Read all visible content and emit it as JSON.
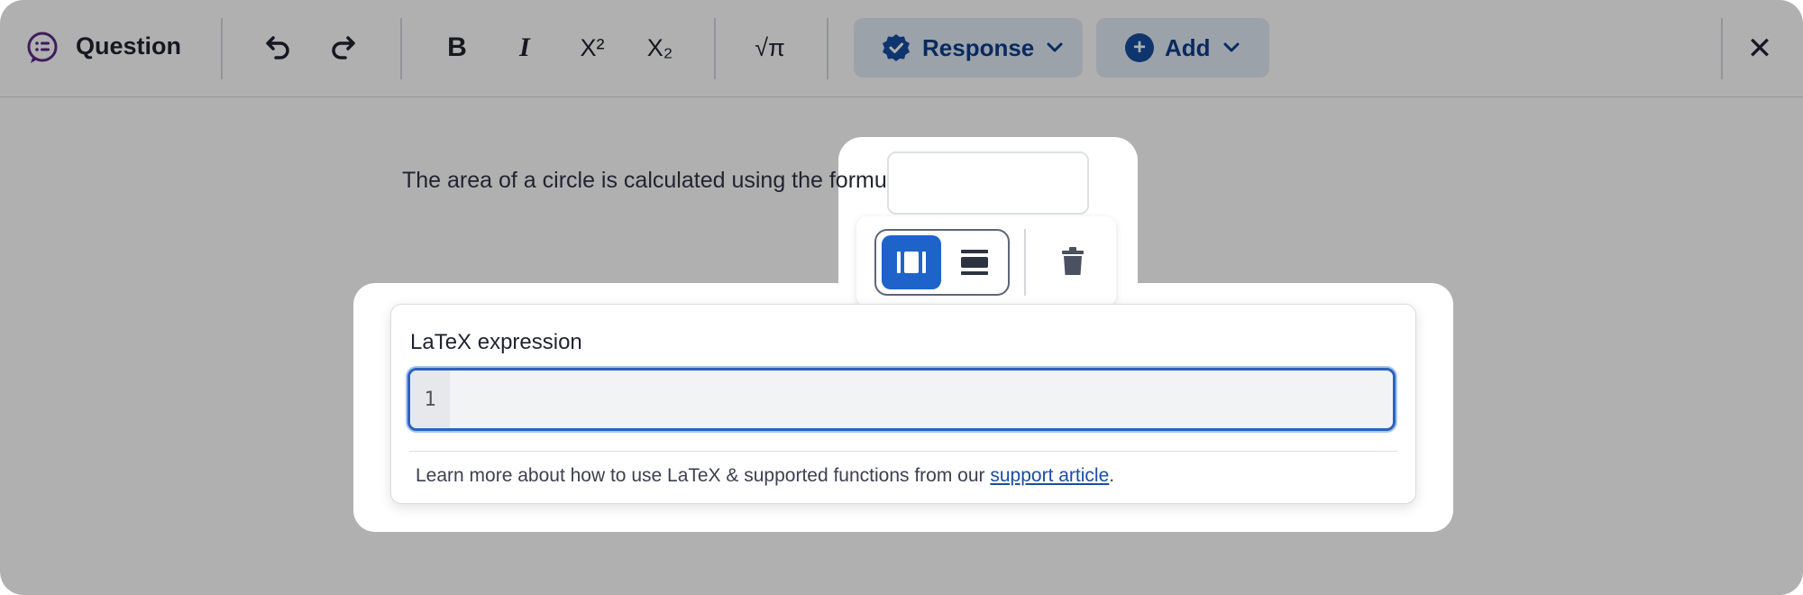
{
  "toolbar": {
    "title": "Question",
    "undo_icon": "undo-icon",
    "redo_icon": "redo-icon",
    "bold_glyph": "B",
    "italic_glyph": "I",
    "superscript_glyph": "X²",
    "subscript_glyph": "X₂",
    "math_glyph": "√π",
    "response_label": "Response",
    "add_label": "Add",
    "add_glyph": "+",
    "close_glyph": "✕"
  },
  "content": {
    "sentence": "The area of a circle is calculated using the formula"
  },
  "latex": {
    "title": "LaTeX expression",
    "line_number": "1",
    "help_prefix": "Learn more about how to use LaTeX & supported functions from our ",
    "help_link": "support article",
    "help_suffix": "."
  },
  "colors": {
    "accent": "#1e63c9",
    "pill_bg": "#e3ebf7",
    "pill_text": "#0e3e8a",
    "question_icon": "#5b2a86"
  }
}
